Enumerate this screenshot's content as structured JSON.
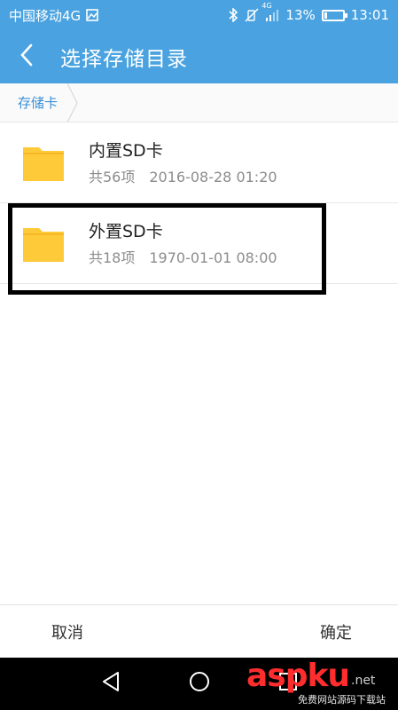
{
  "status_bar": {
    "carrier": "中国移动4G",
    "network_badge": "4G",
    "battery_percent": "13%",
    "battery_level": 0.13,
    "time": "13:01",
    "icons": [
      "image-icon",
      "bluetooth-icon",
      "vibrate-off-icon",
      "signal-icon",
      "battery-icon"
    ]
  },
  "header": {
    "title": "选择存储目录",
    "back_icon": "back-arrow-icon"
  },
  "breadcrumb": {
    "items": [
      {
        "label": "存储卡"
      }
    ]
  },
  "list": {
    "items": [
      {
        "name": "内置SD卡",
        "count": "共56项",
        "date": "2016-08-28 01:20",
        "icon": "folder-icon"
      },
      {
        "name": "外置SD卡",
        "count": "共18项",
        "date": "1970-01-01 08:00",
        "icon": "folder-icon"
      }
    ]
  },
  "actions": {
    "cancel_label": "取消",
    "ok_label": "确定"
  },
  "nav_bar": {
    "icons": [
      "nav-back-icon",
      "nav-home-icon",
      "nav-recent-icon"
    ]
  },
  "watermark": {
    "logo_text": "aspku",
    "suffix": ".net",
    "tagline": "免费网站源码下载站"
  },
  "colors": {
    "header_bg": "#4aa3e0",
    "folder": "#ffca3a",
    "breadcrumb_text": "#3b8fd6",
    "watermark_red": "#ff2d2d"
  }
}
